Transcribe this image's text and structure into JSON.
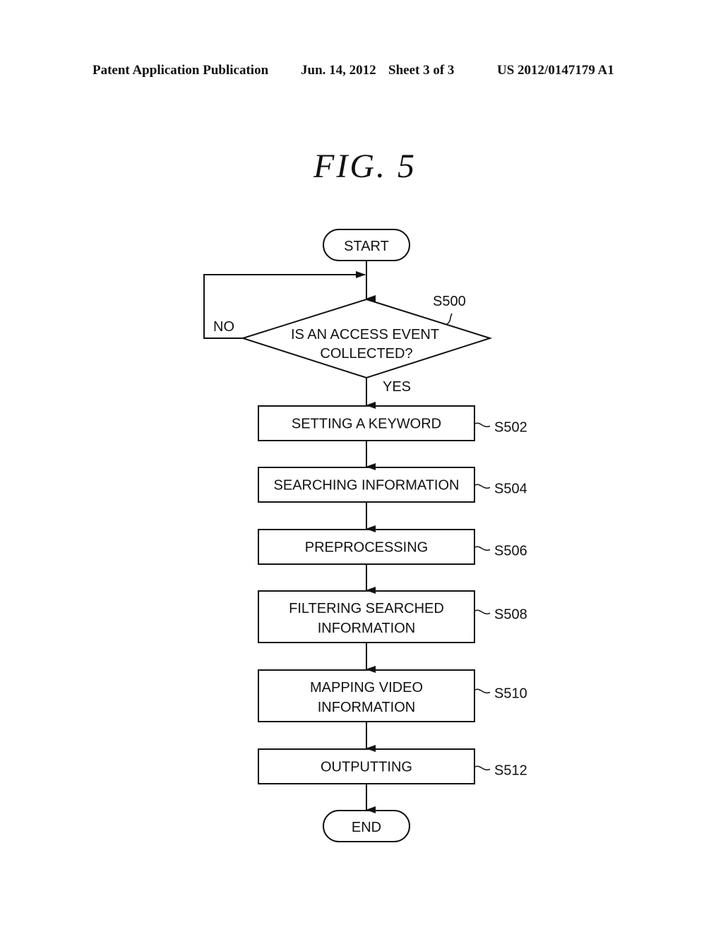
{
  "header": {
    "publication": "Patent Application Publication",
    "date": "Jun. 14, 2012",
    "sheet": "Sheet 3 of 3",
    "number": "US 2012/0147179 A1"
  },
  "figure": {
    "title": "FIG. 5"
  },
  "flowchart": {
    "start": "START",
    "end": "END",
    "decision": {
      "id": "S500",
      "lines": [
        "IS AN ACCESS EVENT",
        "COLLECTED?"
      ],
      "no_label": "NO",
      "yes_label": "YES"
    },
    "steps": [
      {
        "id": "S502",
        "lines": [
          "SETTING A KEYWORD"
        ]
      },
      {
        "id": "S504",
        "lines": [
          "SEARCHING INFORMATION"
        ]
      },
      {
        "id": "S506",
        "lines": [
          "PREPROCESSING"
        ]
      },
      {
        "id": "S508",
        "lines": [
          "FILTERING SEARCHED",
          "INFORMATION"
        ]
      },
      {
        "id": "S510",
        "lines": [
          "MAPPING VIDEO",
          "INFORMATION"
        ]
      },
      {
        "id": "S512",
        "lines": [
          "OUTPUTTING"
        ]
      }
    ]
  }
}
